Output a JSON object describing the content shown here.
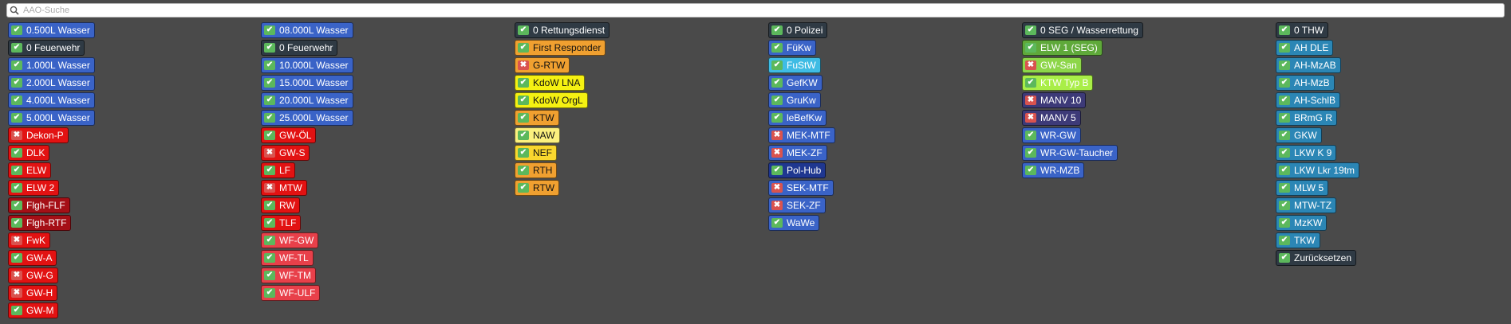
{
  "search": {
    "placeholder": "AAO-Suche",
    "icon": "search-icon"
  },
  "columns": [
    [
      {
        "label": "0.500L Wasser",
        "state": "on",
        "color": "blue"
      },
      {
        "label": "0 Feuerwehr",
        "state": "on",
        "color": "black"
      },
      {
        "label": "1.000L Wasser",
        "state": "on",
        "color": "blue"
      },
      {
        "label": "2.000L Wasser",
        "state": "on",
        "color": "blue"
      },
      {
        "label": "4.000L Wasser",
        "state": "on",
        "color": "blue"
      },
      {
        "label": "5.000L Wasser",
        "state": "on",
        "color": "blue"
      },
      {
        "label": "Dekon-P",
        "state": "off",
        "color": "red"
      },
      {
        "label": "DLK",
        "state": "on",
        "color": "red"
      },
      {
        "label": "ELW",
        "state": "on",
        "color": "red"
      },
      {
        "label": "ELW 2",
        "state": "on",
        "color": "red"
      },
      {
        "label": "Flgh-FLF",
        "state": "on",
        "color": "darkred"
      },
      {
        "label": "Flgh-RTF",
        "state": "on",
        "color": "darkred"
      },
      {
        "label": "FwK",
        "state": "off",
        "color": "red"
      },
      {
        "label": "GW-A",
        "state": "on",
        "color": "red"
      },
      {
        "label": "GW-G",
        "state": "off",
        "color": "red"
      },
      {
        "label": "GW-H",
        "state": "off",
        "color": "red"
      },
      {
        "label": "GW-M",
        "state": "on",
        "color": "red"
      }
    ],
    [
      {
        "label": "08.000L Wasser",
        "state": "on",
        "color": "blue"
      },
      {
        "label": "0 Feuerwehr",
        "state": "on",
        "color": "black"
      },
      {
        "label": "10.000L Wasser",
        "state": "on",
        "color": "blue"
      },
      {
        "label": "15.000L Wasser",
        "state": "on",
        "color": "blue"
      },
      {
        "label": "20.000L Wasser",
        "state": "on",
        "color": "blue"
      },
      {
        "label": "25.000L Wasser",
        "state": "on",
        "color": "blue"
      },
      {
        "label": "GW-ÖL",
        "state": "on",
        "color": "red"
      },
      {
        "label": "GW-S",
        "state": "off",
        "color": "red"
      },
      {
        "label": "LF",
        "state": "on",
        "color": "red"
      },
      {
        "label": "MTW",
        "state": "off",
        "color": "red"
      },
      {
        "label": "RW",
        "state": "on",
        "color": "red"
      },
      {
        "label": "TLF",
        "state": "on",
        "color": "red"
      },
      {
        "label": "WF-GW",
        "state": "on",
        "color": "redpink"
      },
      {
        "label": "WF-TL",
        "state": "on",
        "color": "redpink"
      },
      {
        "label": "WF-TM",
        "state": "on",
        "color": "redpink"
      },
      {
        "label": "WF-ULF",
        "state": "on",
        "color": "redpink"
      }
    ],
    [
      {
        "label": "0 Rettungsdienst",
        "state": "on",
        "color": "black"
      },
      {
        "label": "First Responder",
        "state": "on",
        "color": "orange"
      },
      {
        "label": "G-RTW",
        "state": "off",
        "color": "orange"
      },
      {
        "label": "KdoW LNA",
        "state": "on",
        "color": "yellow"
      },
      {
        "label": "KdoW OrgL",
        "state": "on",
        "color": "yellow"
      },
      {
        "label": "KTW",
        "state": "on",
        "color": "orange"
      },
      {
        "label": "NAW",
        "state": "on",
        "color": "paleyellow"
      },
      {
        "label": "NEF",
        "state": "on",
        "color": "yellowgold"
      },
      {
        "label": "RTH",
        "state": "on",
        "color": "orange"
      },
      {
        "label": "RTW",
        "state": "on",
        "color": "orange"
      }
    ],
    [
      {
        "label": "0 Polizei",
        "state": "on",
        "color": "black"
      },
      {
        "label": "FüKw",
        "state": "on",
        "color": "blue"
      },
      {
        "label": "FuStW",
        "state": "on",
        "color": "cyan"
      },
      {
        "label": "GefKW",
        "state": "on",
        "color": "blue"
      },
      {
        "label": "GruKw",
        "state": "on",
        "color": "blue"
      },
      {
        "label": "leBefKw",
        "state": "on",
        "color": "blue"
      },
      {
        "label": "MEK-MTF",
        "state": "off",
        "color": "blue"
      },
      {
        "label": "MEK-ZF",
        "state": "off",
        "color": "blue"
      },
      {
        "label": "Pol-Hub",
        "state": "on",
        "color": "navy"
      },
      {
        "label": "SEK-MTF",
        "state": "off",
        "color": "blue"
      },
      {
        "label": "SEK-ZF",
        "state": "off",
        "color": "blue"
      },
      {
        "label": "WaWe",
        "state": "on",
        "color": "blue"
      }
    ],
    [
      {
        "label": "0 SEG / Wasserrettung",
        "state": "on",
        "color": "black"
      },
      {
        "label": "ELW 1 (SEG)",
        "state": "on",
        "color": "green"
      },
      {
        "label": "GW-San",
        "state": "off",
        "color": "lightgreen"
      },
      {
        "label": "KTW Typ B",
        "state": "on",
        "color": "lime"
      },
      {
        "label": "MANV 10",
        "state": "off",
        "color": "purple"
      },
      {
        "label": "MANV 5",
        "state": "off",
        "color": "purple"
      },
      {
        "label": "WR-GW",
        "state": "on",
        "color": "blue"
      },
      {
        "label": "WR-GW-Taucher",
        "state": "on",
        "color": "blue"
      },
      {
        "label": "WR-MZB",
        "state": "on",
        "color": "blue"
      }
    ],
    [
      {
        "label": "0 THW",
        "state": "on",
        "color": "black"
      },
      {
        "label": "AH DLE",
        "state": "on",
        "color": "teal"
      },
      {
        "label": "AH-MzAB",
        "state": "on",
        "color": "teal"
      },
      {
        "label": "AH-MzB",
        "state": "on",
        "color": "teal"
      },
      {
        "label": "AH-SchlB",
        "state": "on",
        "color": "teal"
      },
      {
        "label": "BRmG R",
        "state": "on",
        "color": "teal"
      },
      {
        "label": "GKW",
        "state": "on",
        "color": "teal"
      },
      {
        "label": "LKW K 9",
        "state": "on",
        "color": "teal"
      },
      {
        "label": "LKW Lkr 19tm",
        "state": "on",
        "color": "teal"
      },
      {
        "label": "MLW 5",
        "state": "on",
        "color": "teal"
      },
      {
        "label": "MTW-TZ",
        "state": "on",
        "color": "teal"
      },
      {
        "label": "MzKW",
        "state": "on",
        "color": "teal"
      },
      {
        "label": "TKW",
        "state": "on",
        "color": "teal"
      },
      {
        "label": "Zurücksetzen",
        "state": "on",
        "color": "black"
      }
    ]
  ]
}
